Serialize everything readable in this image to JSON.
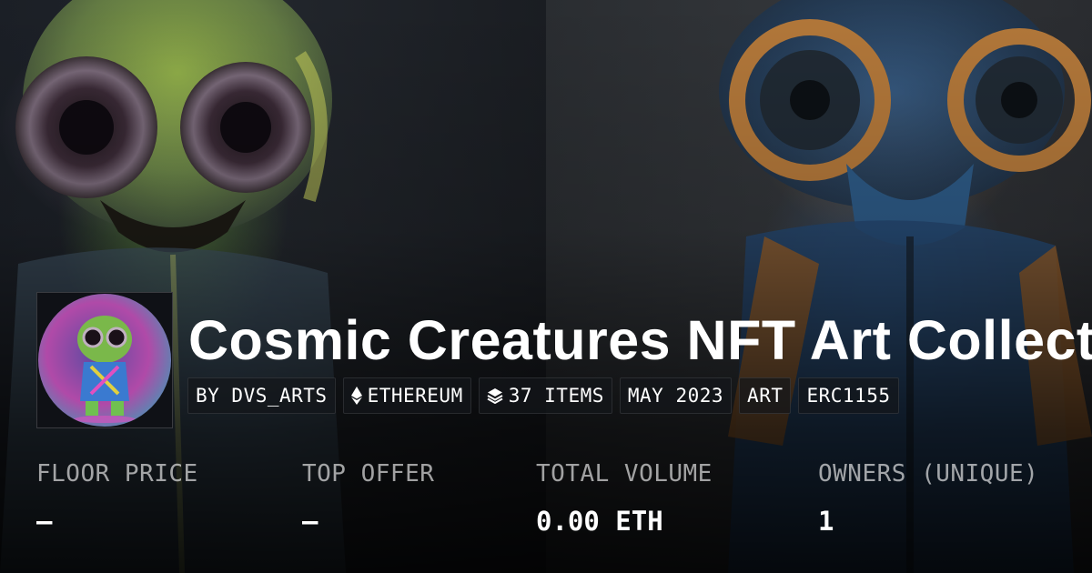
{
  "collection": {
    "title": "Cosmic Creatures NFT Art Collection"
  },
  "tags": [
    {
      "label": "BY DVS_ARTS",
      "icon": ""
    },
    {
      "label": "ETHEREUM",
      "icon": "ethereum-icon"
    },
    {
      "label": "37 ITEMS",
      "icon": "layers-icon"
    },
    {
      "label": "MAY 2023",
      "icon": ""
    },
    {
      "label": "ART",
      "icon": ""
    },
    {
      "label": "ERC1155",
      "icon": ""
    }
  ],
  "stats": [
    {
      "label": "FLOOR PRICE",
      "value": "–"
    },
    {
      "label": "TOP OFFER",
      "value": "–"
    },
    {
      "label": "TOTAL VOLUME",
      "value": "0.00 ETH"
    },
    {
      "label": "OWNERS (UNIQUE)",
      "value": "1"
    }
  ],
  "colors": {
    "text": "#ffffff",
    "muted": "#9fa1a5",
    "tag_bg": "#14161a"
  }
}
